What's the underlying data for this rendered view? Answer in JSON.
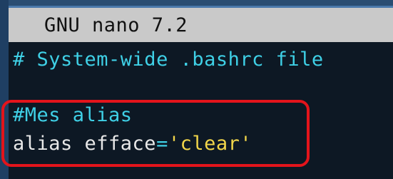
{
  "editor": {
    "title": "GNU nano 7.2",
    "lines": [
      "# System-wide .bashrc file",
      "",
      "#Mes alias",
      {
        "keyword": "alias efface",
        "equals": "=",
        "value": "'clear'"
      }
    ]
  },
  "colors": {
    "background": "#0d1824",
    "title_bar": "#c9c9c9",
    "comment": "#3fd0e6",
    "string": "#f2d64a",
    "highlight": "#e3141b"
  }
}
